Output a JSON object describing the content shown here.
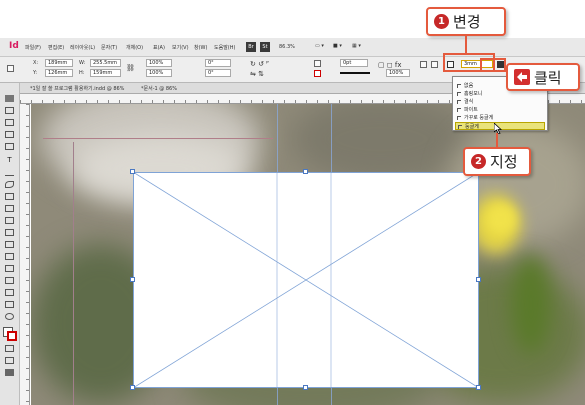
{
  "app": {
    "logo": "Id",
    "menus": [
      "파일(F)",
      "편집(E)",
      "레이아웃(L)",
      "문자(T)",
      "개체(O)",
      "표(A)",
      "보기(V)",
      "창(W)",
      "도움말(H)"
    ],
    "br_label": "Br",
    "st_label": "St",
    "zoom": "86.3%"
  },
  "control": {
    "x_label": "X:",
    "x_value": "189mm",
    "y_label": "Y:",
    "y_value": "126mm",
    "w_label": "W:",
    "w_value": "255.5mm",
    "h_label": "H:",
    "h_value": "159mm",
    "scale_x": "100%",
    "scale_y": "100%",
    "rotate": "0°",
    "shear": "0°",
    "stroke_weight": "0pt",
    "opacity": "100%",
    "frame_fit_value": "3mm"
  },
  "tabs": {
    "doc_tab": "*1일 잘 쓸 프로그램 활용하기.indd @ 86%",
    "doc_tab2": "*문서-1 @ 86%"
  },
  "dropdown": {
    "items": [
      "없음",
      "홈링모니",
      "결식",
      "파이트",
      "가꾸로 둥글게",
      "둥글게"
    ],
    "selected_index": 5
  },
  "callouts": {
    "step1_number": "1",
    "step1_text": "변경",
    "click_text": "클릭",
    "step2_number": "2",
    "step2_text": "지정"
  },
  "colors": {
    "accent": "#e45a3d",
    "badge": "#c62828",
    "frame_line": "#7fa3d6",
    "selected_item": "#e9e37a"
  }
}
